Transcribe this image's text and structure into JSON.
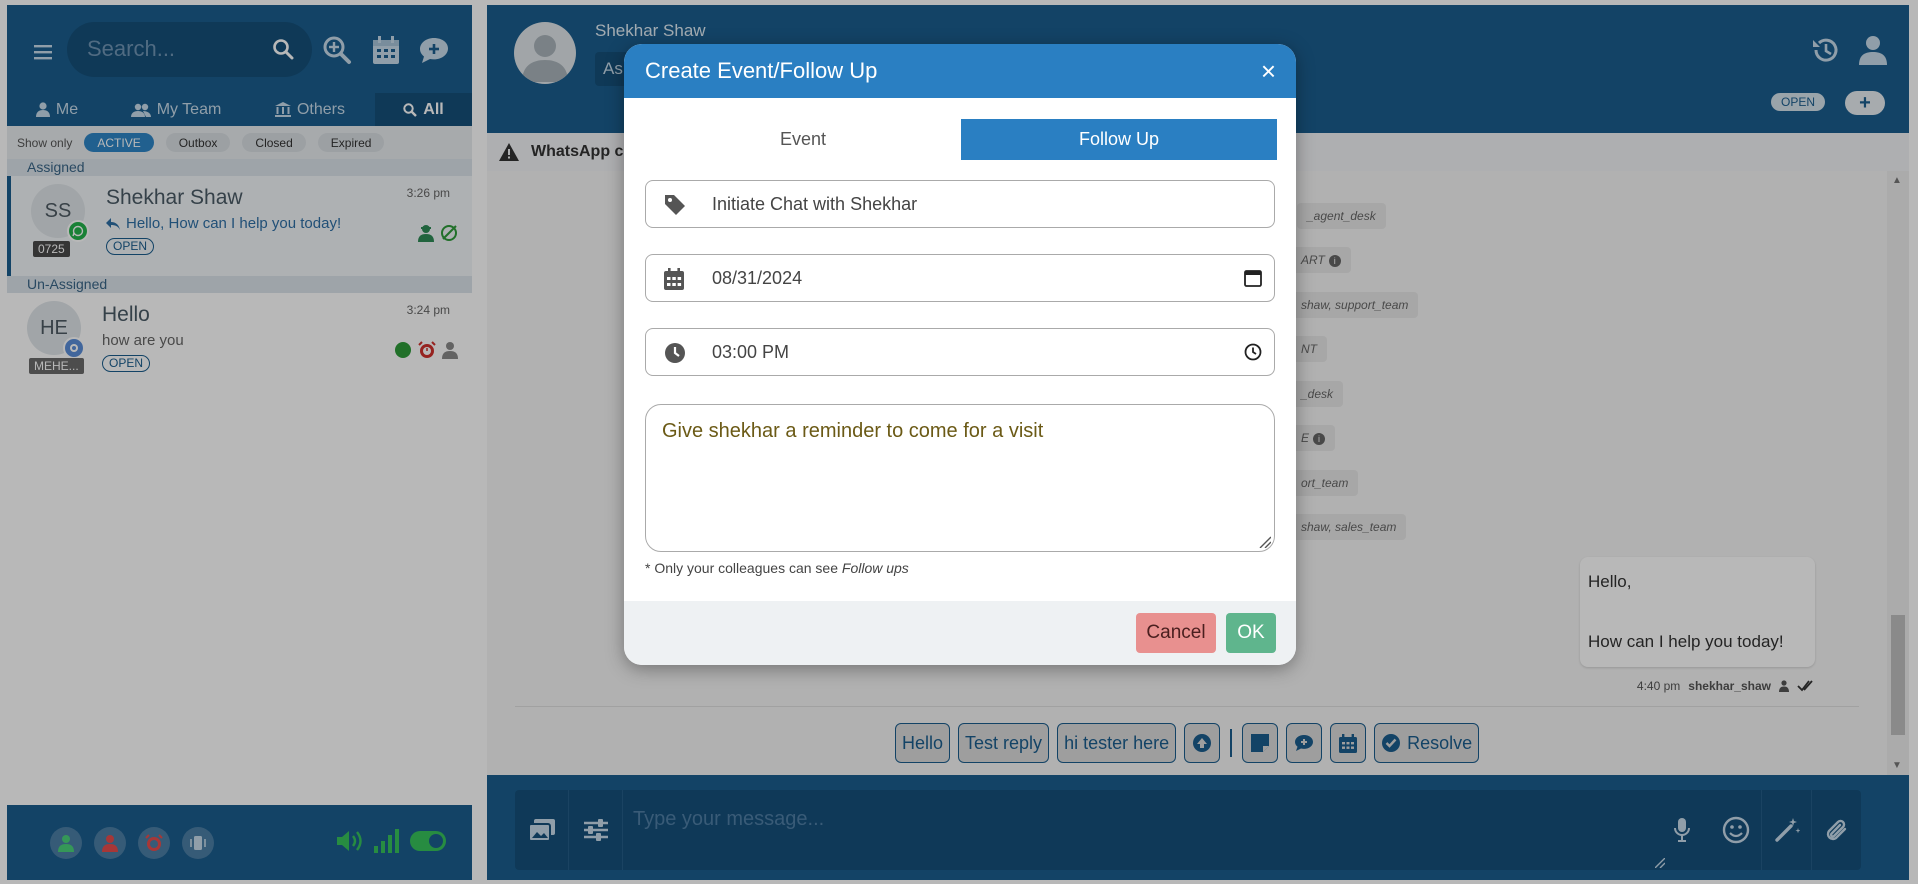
{
  "colors": {
    "brand": "#1b5e8e",
    "modal_header": "#2a7fc2",
    "cancel": "#e8908f",
    "ok": "#5fb58d",
    "whatsapp": "#25b34b"
  },
  "sidebar": {
    "search_placeholder": "Search...",
    "scope_tabs": [
      {
        "label": "Me",
        "icon": "user-icon"
      },
      {
        "label": "My Team",
        "icon": "users-icon"
      },
      {
        "label": "Others",
        "icon": "bank-icon"
      },
      {
        "label": "All",
        "icon": "search-icon",
        "active": true
      }
    ],
    "filter": {
      "label": "Show only",
      "options": [
        "ACTIVE",
        "Outbox",
        "Closed",
        "Expired"
      ],
      "selected": "ACTIVE"
    },
    "groups": [
      {
        "title": "Assigned",
        "items": [
          {
            "initials": "SS",
            "name": "Shekhar Shaw",
            "time": "3:26 pm",
            "preview": "Hello, How can I help you today!",
            "status": "OPEN",
            "agent_tag": "0725",
            "channel": "whatsapp-icon"
          }
        ]
      },
      {
        "title": "Un-Assigned",
        "items": [
          {
            "initials": "HE",
            "name": "Hello",
            "time": "3:24 pm",
            "preview": "how are you",
            "status": "OPEN",
            "agent_tag": "MEHE...",
            "channel": "chat-icon"
          }
        ]
      }
    ]
  },
  "chat": {
    "contact_name": "Shekhar Shaw",
    "assign_stub": "As",
    "status": "OPEN",
    "add_label": "+",
    "notice": "WhatsApp c",
    "system_chips": [
      "_agent_desk",
      "ART",
      "shaw, support_team",
      "NT",
      "_desk",
      "E",
      "ort_team",
      "shaw, sales_team"
    ],
    "message": {
      "line1": "Hello,",
      "line2": "How can I help you today!",
      "time": "4:40 pm",
      "agent": "shekhar_shaw"
    },
    "quick_replies": [
      "Hello",
      "Test reply",
      "hi tester here"
    ],
    "resolve_label": "Resolve",
    "composer_placeholder": "Type your message..."
  },
  "modal": {
    "title": "Create Event/Follow Up",
    "close": "×",
    "tabs": [
      "Event",
      "Follow Up"
    ],
    "active_tab": "Follow Up",
    "subject": "Initiate Chat with Shekhar",
    "date": "08/31/2024",
    "time": "03:00  PM",
    "notes": "Give shekhar a reminder to come for a visit",
    "hint_prefix": "* Only your colleagues can see ",
    "hint_emphasis": "Follow ups",
    "cancel_label": "Cancel",
    "ok_label": "OK"
  }
}
